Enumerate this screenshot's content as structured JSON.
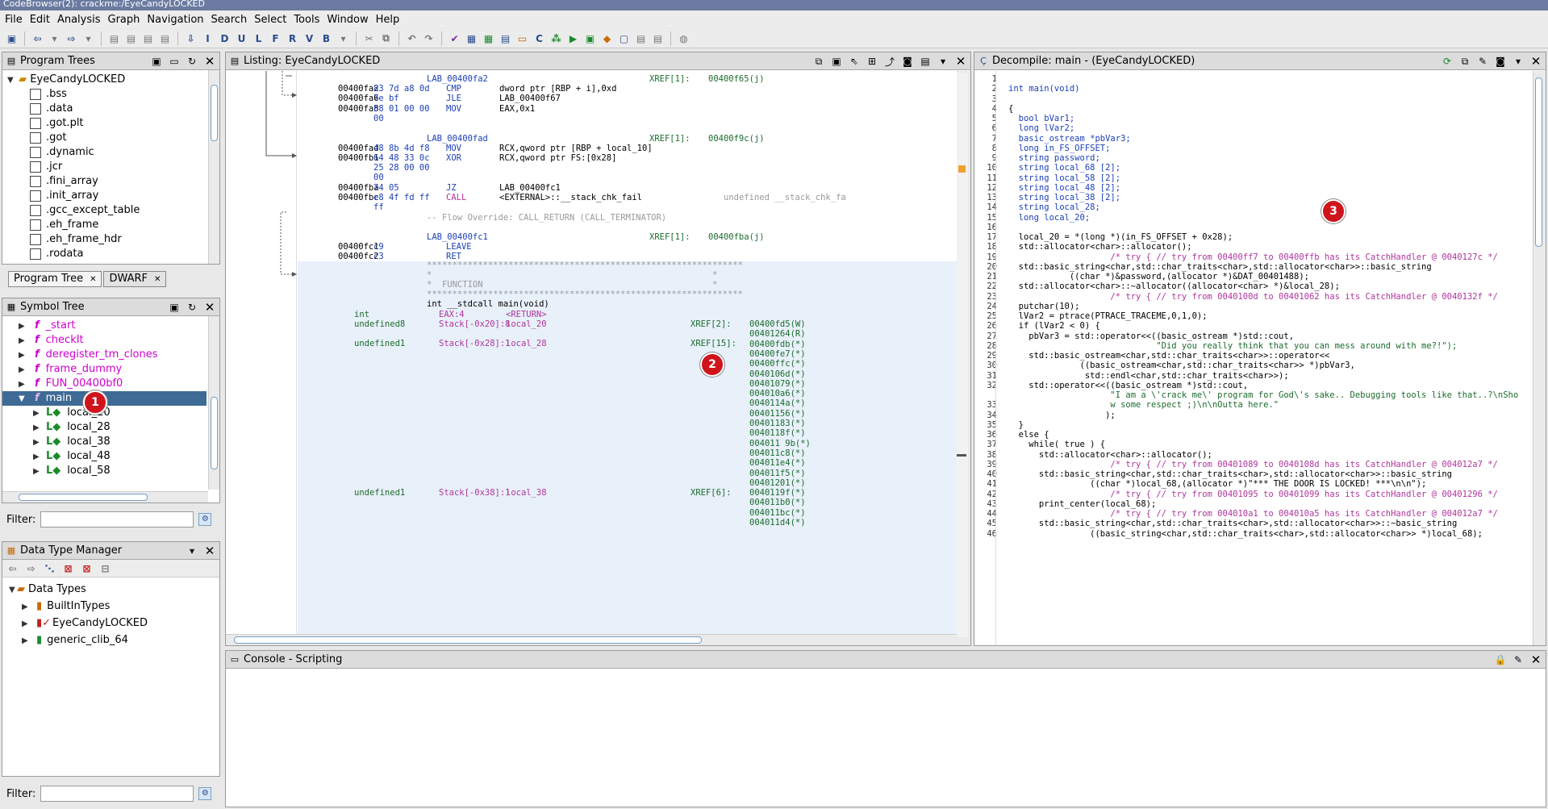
{
  "app": {
    "title": "CodeBrowser(2): crackme:/EyeCandyLOCKED",
    "menus": [
      "File",
      "Edit",
      "Analysis",
      "Graph",
      "Navigation",
      "Search",
      "Select",
      "Tools",
      "Window",
      "Help"
    ]
  },
  "program_trees": {
    "title": "Program Trees",
    "root": "EyeCandyLOCKED",
    "sections": [
      ".bss",
      ".data",
      ".got.plt",
      ".got",
      ".dynamic",
      ".jcr",
      ".fini_array",
      ".init_array",
      ".gcc_except_table",
      ".eh_frame",
      ".eh_frame_hdr",
      ".rodata"
    ],
    "tabs": [
      "Program Tree",
      "DWARF"
    ]
  },
  "symbol_tree": {
    "title": "Symbol Tree",
    "functions": [
      "_start",
      "checkIt",
      "deregister_tm_clones",
      "frame_dummy",
      "FUN_00400bf0",
      "main"
    ],
    "locals": [
      "local_20",
      "local_28",
      "local_38",
      "local_48",
      "local_58"
    ],
    "filter_label": "Filter:"
  },
  "data_type_manager": {
    "title": "Data Type Manager",
    "root": "Data Types",
    "items": [
      "BuiltInTypes",
      "EyeCandyLOCKED",
      "generic_clib_64"
    ],
    "filter_label": "Filter:"
  },
  "listing": {
    "title": "Listing:  EyeCandyLOCKED",
    "lines": [
      {
        "label": "LAB_00400fa2",
        "xref": "XREF[1]:",
        "xaddr": "00400f65(j)"
      },
      {
        "addr": "00400fa2",
        "bytes": "83 7d a8 0d",
        "mn": "CMP",
        "op": "dword ptr [RBP + i],0xd"
      },
      {
        "addr": "00400fa6",
        "bytes": "7e bf",
        "mn": "JLE",
        "op": "LAB_00400f67"
      },
      {
        "addr": "00400fa8",
        "bytes": "b8 01 00 00",
        "mn": "MOV",
        "op": "EAX,0x1"
      },
      {
        "bytes": "00"
      },
      {
        "label": "LAB_00400fad",
        "xref": "XREF[1]:",
        "xaddr": "00400f9c(j)"
      },
      {
        "addr": "00400fad",
        "bytes": "48 8b 4d f8",
        "mn": "MOV",
        "op": "RCX,qword ptr [RBP + local_10]"
      },
      {
        "addr": "00400fb1",
        "bytes": "64 48 33 0c",
        "mn": "XOR",
        "op": "RCX,qword ptr FS:[0x28]"
      },
      {
        "bytes": "25 28 00 00"
      },
      {
        "bytes": "00"
      },
      {
        "addr": "00400fba",
        "bytes": "74 05",
        "mn": "JZ",
        "op": "LAB_00400fc1"
      },
      {
        "addr": "00400fbc",
        "bytes": "e8 4f fd ff",
        "mn": "CALL",
        "op": "<EXTERNAL>::__stack_chk_fail",
        "cmt": "undefined __stack_chk_fa"
      },
      {
        "bytes": "ff"
      },
      {
        "cmt": "-- Flow Override: CALL_RETURN (CALL_TERMINATOR)"
      },
      {
        "label": "LAB_00400fc1",
        "xref": "XREF[1]:",
        "xaddr": "00400fba(j)"
      },
      {
        "addr": "00400fc1",
        "bytes": "c9",
        "mn": "LEAVE"
      },
      {
        "addr": "00400fc2",
        "bytes": "c3",
        "mn": "RET"
      }
    ],
    "stars": "**************************************************************",
    "func_header": "*  FUNCTION",
    "signature": "int __stdcall main(void)",
    "params": [
      {
        "type": "int",
        "loc": "EAX:4",
        "name": "<RETURN>"
      },
      {
        "type": "undefined8",
        "loc": "Stack[-0x20]:8",
        "name": "local_20",
        "xref": "XREF[2]:"
      },
      {
        "type": "undefined1",
        "loc": "Stack[-0x28]:1",
        "name": "local_28",
        "xref": "XREF[15]:"
      },
      {
        "type": "undefined1",
        "loc": "Stack[-0x38]:1",
        "name": "local_38",
        "xref": "XREF[6]:"
      }
    ],
    "xrefs": [
      "00400fd5(W)",
      "00401264(R)",
      "00400fdb(*)",
      "00400fe7(*)",
      "00400ffc(*)",
      "0040106d(*)",
      "00401079(*)",
      "004010a6(*)",
      "0040114a(*)",
      "00401156(*)",
      "00401183(*)",
      "0040118f(*)",
      "004011 9b(*)",
      "004011c8(*)",
      "004011e4(*)",
      "004011f5(*)",
      "00401201(*)",
      "0040119f(*)",
      "004011b0(*)",
      "004011bc(*)",
      "004011d4(*)"
    ]
  },
  "decompile": {
    "title": "Decompile: main -  (EyeCandyLOCKED)",
    "lines": [
      "",
      "int main(void)",
      "",
      "{",
      "  bool bVar1;",
      "  long lVar2;",
      "  basic_ostream *pbVar3;",
      "  long in_FS_OFFSET;",
      "  string password;",
      "  string local_68 [2];",
      "  string local_58 [2];",
      "  string local_48 [2];",
      "  string local_38 [2];",
      "  string local_28;",
      "  long local_20;",
      "",
      "  local_20 = *(long *)(in_FS_OFFSET + 0x28);",
      "  std::allocator<char>::allocator();",
      "                    /* try { // try from 00400ff7 to 00400ffb has its CatchHandler @ 0040127c */",
      "  std::basic_string<char,std::char_traits<char>,std::allocator<char>>::basic_string",
      "            ((char *)&password,(allocator *)&DAT_00401488);",
      "  std::allocator<char>::~allocator((allocator<char> *)&local_28);",
      "                    /* try { // try from 0040100d to 00401062 has its CatchHandler @ 0040132f */",
      "  putchar(10);",
      "  lVar2 = ptrace(PTRACE_TRACEME,0,1,0);",
      "  if (lVar2 < 0) {",
      "    pbVar3 = std::operator<<((basic_ostream *)std::cout,",
      "                             \"Did you really think that you can mess around with me?!\");",
      "    std::basic_ostream<char,std::char_traits<char>>::operator<<",
      "              ((basic_ostream<char,std::char_traits<char>> *)pbVar3,",
      "               std::endl<char,std::char_traits<char>>);",
      "    std::operator<<((basic_ostream *)std::cout,",
      "                    \"I am a \\'crack me\\' program for God\\'s sake.. Debugging tools like that..?\\nSho",
      "                    w some respect ;)\\n\\nOutta here.\"",
      "                   );",
      "  }",
      "  else {",
      "    while( true ) {",
      "      std::allocator<char>::allocator();",
      "                    /* try { // try from 00401089 to 0040108d has its CatchHandler @ 004012a7 */",
      "      std::basic_string<char,std::char_traits<char>,std::allocator<char>>::basic_string",
      "                ((char *)local_68,(allocator *)\"*** THE DOOR IS LOCKED! ***\\n\\n\");",
      "                    /* try { // try from 00401095 to 00401099 has its CatchHandler @ 00401296 */",
      "      print_center(local_68);",
      "                    /* try { // try from 004010a1 to 004010a5 has its CatchHandler @ 004012a7 */",
      "      std::basic_string<char,std::char_traits<char>,std::allocator<char>>::~basic_string",
      "                ((basic_string<char,std::char_traits<char>,std::allocator<char>> *)local_68);"
    ],
    "line_numbers": [
      "1",
      "2",
      "3",
      "4",
      "5",
      "6",
      "7",
      "8",
      "9",
      "10",
      "11",
      "12",
      "13",
      "14",
      "15",
      "16",
      "17",
      "18",
      "19",
      "20",
      "21",
      "22",
      "23",
      "24",
      "25",
      "26",
      "27",
      "28",
      "29",
      "30",
      "31",
      "32",
      "",
      "33",
      "34",
      "35",
      "36",
      "37",
      "38",
      "39",
      "40",
      "41",
      "42",
      "43",
      "44",
      "45",
      "46"
    ]
  },
  "console": {
    "title": "Console - Scripting"
  },
  "callouts": [
    "1",
    "2",
    "3"
  ]
}
